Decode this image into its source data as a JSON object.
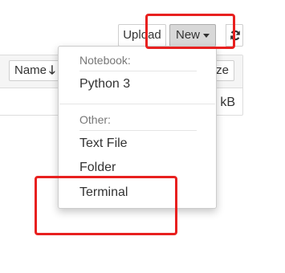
{
  "toolbar": {
    "upload_label": "Upload",
    "new_label": "New",
    "refresh_icon": "refresh-icon"
  },
  "file_list": {
    "sort_label": "Name",
    "sort_icon": "arrow-down-icon",
    "size_header": "ze",
    "size_value": "kB"
  },
  "new_menu": {
    "notebook_header": "Notebook:",
    "notebook_items": [
      {
        "label": "Python 3"
      }
    ],
    "other_header": "Other:",
    "other_items": [
      {
        "label": "Text File"
      },
      {
        "label": "Folder"
      },
      {
        "label": "Terminal"
      }
    ]
  },
  "colors": {
    "highlight": "#e8201f",
    "new_button_active_bg": "#d8d8d8",
    "accent_refresh": "#333333"
  }
}
